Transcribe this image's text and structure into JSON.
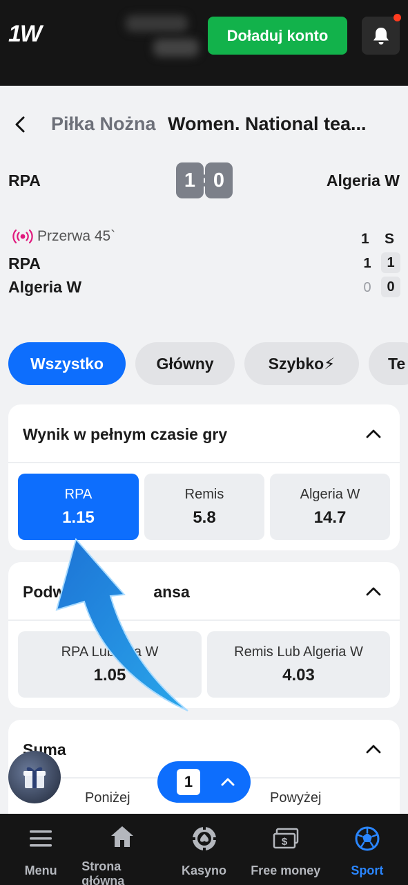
{
  "header": {
    "logo": "1W",
    "topup_label": "Doładuj konto"
  },
  "breadcrumb": {
    "sport": "Piłka Nożna",
    "event": "Women. National tea..."
  },
  "match": {
    "home": "RPA",
    "away": "Algeria W",
    "score_home": "1",
    "score_away": "0",
    "status": "Przerwa 45`",
    "columns": [
      "1",
      "S"
    ],
    "rows": [
      {
        "team": "RPA",
        "p1": "1",
        "s": "1"
      },
      {
        "team": "Algeria W",
        "p1": "0",
        "s": "0"
      }
    ]
  },
  "tabs": [
    {
      "label": "Wszystko",
      "active": true
    },
    {
      "label": "Główny",
      "active": false
    },
    {
      "label": "Szybko⚡",
      "active": false
    },
    {
      "label": "Te",
      "active": false
    }
  ],
  "markets": [
    {
      "title": "Wynik w pełnym czasie gry",
      "outcomes": [
        {
          "label": "RPA",
          "odd": "1.15",
          "selected": true
        },
        {
          "label": "Remis",
          "odd": "5.8",
          "selected": false
        },
        {
          "label": "Algeria W",
          "odd": "14.7",
          "selected": false
        }
      ]
    },
    {
      "title": "Podwójna szansa",
      "title_visible": "Podw",
      "title_visible_end": "ansa",
      "outcomes": [
        {
          "label": "RPA Lub Algeria W",
          "label_visible": "RPA Lub",
          "label_visible_end": "eria W",
          "odd": "1.05",
          "odd_visible": "1.05",
          "selected": false
        },
        {
          "label": "Remis Lub Algeria W",
          "odd": "4.03",
          "selected": false
        }
      ]
    },
    {
      "title": "Suma",
      "outcomes": [
        {
          "label": "Poniżej"
        },
        {
          "label": "Powyżej"
        }
      ]
    }
  ],
  "betslip": {
    "count": "1"
  },
  "bottom_nav": [
    {
      "label": "Menu",
      "icon": "menu-icon",
      "active": false
    },
    {
      "label": "Strona główna",
      "icon": "home-icon",
      "active": false
    },
    {
      "label": "Kasyno",
      "icon": "casino-chip-icon",
      "active": false
    },
    {
      "label": "Free money",
      "icon": "money-icon",
      "active": false
    },
    {
      "label": "Sport",
      "icon": "soccer-ball-icon",
      "active": true
    }
  ],
  "colors": {
    "primary": "#0d6efd",
    "topup": "#12b24b",
    "dark": "#151515",
    "live": "#e0197d"
  }
}
